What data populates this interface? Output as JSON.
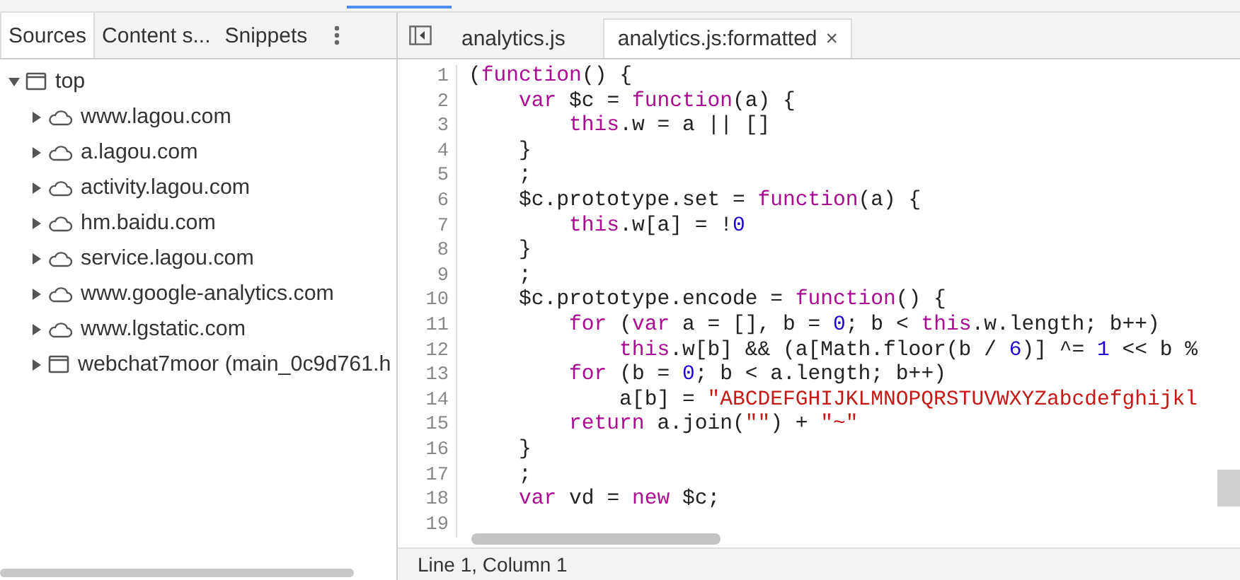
{
  "navigator": {
    "tabs": [
      {
        "label": "Sources",
        "selected": true
      },
      {
        "label": "Content s...",
        "selected": false
      },
      {
        "label": "Snippets",
        "selected": false
      }
    ],
    "tree": [
      {
        "label": "top",
        "kind": "frame",
        "expanded": true,
        "children": [
          {
            "label": "www.lagou.com",
            "kind": "domain",
            "expanded": false
          },
          {
            "label": "a.lagou.com",
            "kind": "domain",
            "expanded": false
          },
          {
            "label": "activity.lagou.com",
            "kind": "domain",
            "expanded": false
          },
          {
            "label": "hm.baidu.com",
            "kind": "domain",
            "expanded": false
          },
          {
            "label": "service.lagou.com",
            "kind": "domain",
            "expanded": false
          },
          {
            "label": "www.google-analytics.com",
            "kind": "domain",
            "expanded": false
          },
          {
            "label": "www.lgstatic.com",
            "kind": "domain",
            "expanded": false
          },
          {
            "label": "webchat7moor (main_0c9d761.h",
            "kind": "frame",
            "expanded": false
          }
        ]
      }
    ]
  },
  "editor": {
    "tabs": [
      {
        "label": "analytics.js",
        "selected": false
      },
      {
        "label": "analytics.js:formatted",
        "selected": true,
        "close": "×"
      }
    ],
    "lines": [
      {
        "number": "1",
        "tokens": [
          {
            "kind": "plain",
            "text": "("
          },
          {
            "kind": "keyword",
            "text": "function"
          },
          {
            "kind": "plain",
            "text": "() {"
          }
        ]
      },
      {
        "number": "2",
        "tokens": [
          {
            "kind": "keyword",
            "text": "    var"
          },
          {
            "kind": "plain",
            "text": " $c = "
          },
          {
            "kind": "keyword",
            "text": "function"
          },
          {
            "kind": "plain",
            "text": "(a) {"
          }
        ]
      },
      {
        "number": "3",
        "tokens": [
          {
            "kind": "keyword",
            "text": "        this"
          },
          {
            "kind": "plain",
            "text": ".w = a || []"
          }
        ]
      },
      {
        "number": "4",
        "tokens": [
          {
            "kind": "plain",
            "text": "    }"
          }
        ]
      },
      {
        "number": "5",
        "tokens": [
          {
            "kind": "plain",
            "text": "    ;"
          }
        ]
      },
      {
        "number": "6",
        "tokens": [
          {
            "kind": "plain",
            "text": "    $c.prototype.set = "
          },
          {
            "kind": "keyword",
            "text": "function"
          },
          {
            "kind": "plain",
            "text": "(a) {"
          }
        ]
      },
      {
        "number": "7",
        "tokens": [
          {
            "kind": "keyword",
            "text": "        this"
          },
          {
            "kind": "plain",
            "text": ".w[a] = !"
          },
          {
            "kind": "number",
            "text": "0"
          }
        ]
      },
      {
        "number": "8",
        "tokens": [
          {
            "kind": "plain",
            "text": "    }"
          }
        ]
      },
      {
        "number": "9",
        "tokens": [
          {
            "kind": "plain",
            "text": "    ;"
          }
        ]
      },
      {
        "number": "10",
        "tokens": [
          {
            "kind": "plain",
            "text": "    $c.prototype.encode = "
          },
          {
            "kind": "keyword",
            "text": "function"
          },
          {
            "kind": "plain",
            "text": "() {"
          }
        ]
      },
      {
        "number": "11",
        "tokens": [
          {
            "kind": "keyword",
            "text": "        for"
          },
          {
            "kind": "plain",
            "text": " ("
          },
          {
            "kind": "keyword",
            "text": "var"
          },
          {
            "kind": "plain",
            "text": " a = [], b = "
          },
          {
            "kind": "number",
            "text": "0"
          },
          {
            "kind": "plain",
            "text": "; b < "
          },
          {
            "kind": "keyword",
            "text": "this"
          },
          {
            "kind": "plain",
            "text": ".w.length; b++)"
          }
        ]
      },
      {
        "number": "12",
        "tokens": [
          {
            "kind": "keyword",
            "text": "            this"
          },
          {
            "kind": "plain",
            "text": ".w[b] && (a[Math.floor(b / "
          },
          {
            "kind": "number",
            "text": "6"
          },
          {
            "kind": "plain",
            "text": ")] ^= "
          },
          {
            "kind": "number",
            "text": "1"
          },
          {
            "kind": "plain",
            "text": " << b %"
          }
        ]
      },
      {
        "number": "13",
        "tokens": [
          {
            "kind": "keyword",
            "text": "        for"
          },
          {
            "kind": "plain",
            "text": " (b = "
          },
          {
            "kind": "number",
            "text": "0"
          },
          {
            "kind": "plain",
            "text": "; b < a.length; b++)"
          }
        ]
      },
      {
        "number": "14",
        "tokens": [
          {
            "kind": "plain",
            "text": "            a[b] = "
          },
          {
            "kind": "string",
            "text": "\"ABCDEFGHIJKLMNOPQRSTUVWXYZabcdefghijkl"
          }
        ]
      },
      {
        "number": "15",
        "tokens": [
          {
            "kind": "keyword",
            "text": "        return"
          },
          {
            "kind": "plain",
            "text": " a.join("
          },
          {
            "kind": "string",
            "text": "\"\""
          },
          {
            "kind": "plain",
            "text": ") + "
          },
          {
            "kind": "string",
            "text": "\"~\""
          }
        ]
      },
      {
        "number": "16",
        "tokens": [
          {
            "kind": "plain",
            "text": "    }"
          }
        ]
      },
      {
        "number": "17",
        "tokens": [
          {
            "kind": "plain",
            "text": "    ;"
          }
        ]
      },
      {
        "number": "18",
        "tokens": [
          {
            "kind": "keyword",
            "text": "    var"
          },
          {
            "kind": "plain",
            "text": " vd = "
          },
          {
            "kind": "keyword",
            "text": "new"
          },
          {
            "kind": "plain",
            "text": " $c;"
          }
        ]
      },
      {
        "number": "19"
      }
    ]
  },
  "status_bar": {
    "position": "Line 1, Column 1"
  }
}
